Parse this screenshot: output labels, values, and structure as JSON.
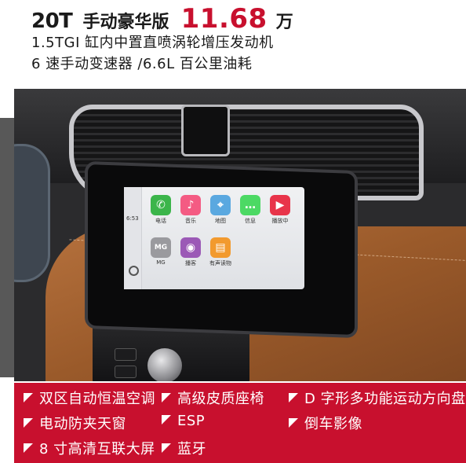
{
  "header": {
    "model": "20T",
    "trim": "手动豪华版",
    "price": "11.68",
    "price_unit": "万",
    "spec_line1": "1.5TGI 缸内中置直喷涡轮增压发动机",
    "spec_line2": "6 速手动变速器 /6.6L 百公里油耗"
  },
  "screen": {
    "time": "6:53",
    "apps_row1": [
      {
        "icon": "phone-icon",
        "label": "电话",
        "color": "#3bb54a",
        "glyph": "✆"
      },
      {
        "icon": "music-icon",
        "label": "音乐",
        "color": "#f45b83",
        "glyph": "♪"
      },
      {
        "icon": "maps-icon",
        "label": "地图",
        "color": "#5aa8e0",
        "glyph": "⌖"
      },
      {
        "icon": "messages-icon",
        "label": "信息",
        "color": "#4cd964",
        "glyph": "…"
      },
      {
        "icon": "now-playing-icon",
        "label": "播放中",
        "color": "#e8344a",
        "glyph": "▶"
      }
    ],
    "apps_row2": [
      {
        "icon": "mg-icon",
        "label": "MG",
        "color": "#9a9a9e",
        "glyph": "MG"
      },
      {
        "icon": "podcasts-icon",
        "label": "播客",
        "color": "#9b59b6",
        "glyph": "◉"
      },
      {
        "icon": "audiobooks-icon",
        "label": "有声读物",
        "color": "#f29a2e",
        "glyph": "▤"
      }
    ]
  },
  "features": {
    "col1": [
      "双区自动恒温空调",
      "电动防夹天窗",
      "8 寸高清互联大屏"
    ],
    "col2": [
      "高级皮质座椅",
      "ESP",
      "蓝牙"
    ],
    "col3": [
      "D 字形多功能运动方向盘",
      "倒车影像"
    ]
  },
  "colors": {
    "accent_red": "#c8102e",
    "leather_brown": "#a0602d"
  }
}
